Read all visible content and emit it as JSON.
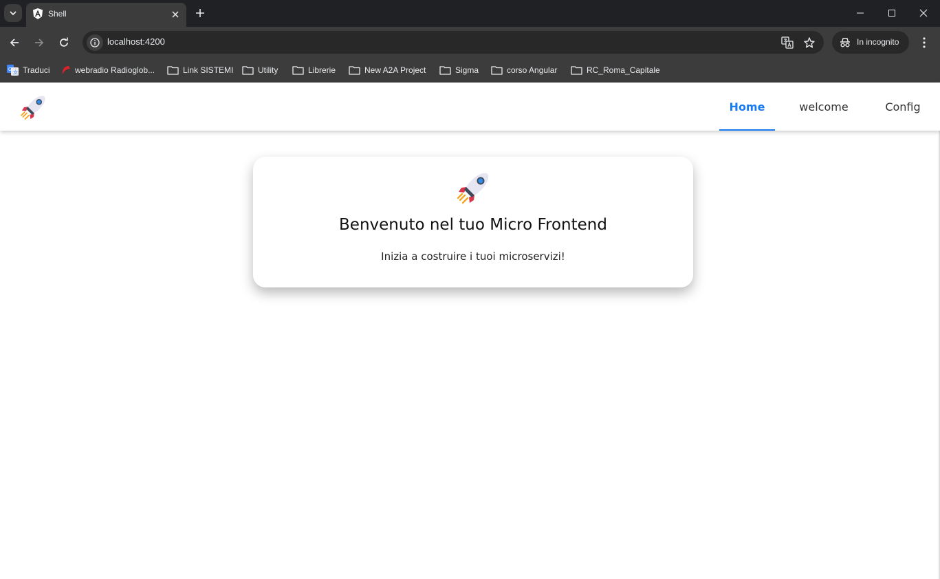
{
  "browser": {
    "tab": {
      "title": "Shell",
      "favicon": "angular-icon"
    },
    "address": {
      "url": "localhost:4200"
    },
    "incognito_label": "In incognito",
    "bookmarks": [
      {
        "label": "Traduci",
        "icon": "google-translate-icon"
      },
      {
        "label": "webradio Radioglob...",
        "icon": "radio-icon"
      },
      {
        "label": "Link SISTEMI",
        "icon": "folder-icon"
      },
      {
        "label": "Utility",
        "icon": "folder-icon"
      },
      {
        "label": "Librerie",
        "icon": "folder-icon"
      },
      {
        "label": "New A2A Project",
        "icon": "folder-icon"
      },
      {
        "label": "Sigma",
        "icon": "folder-icon"
      },
      {
        "label": "corso Angular",
        "icon": "folder-icon"
      },
      {
        "label": "RC_Roma_Capitale",
        "icon": "folder-icon"
      }
    ]
  },
  "app": {
    "logo": "rocket-icon",
    "nav": [
      {
        "label": "Home",
        "active": true
      },
      {
        "label": "welcome",
        "active": false
      },
      {
        "label": "Config",
        "active": false
      }
    ],
    "card": {
      "icon": "rocket-icon",
      "title": "Benvenuto nel tuo Micro Frontend",
      "subtitle": "Inizia a costruire i tuoi microservizi!"
    },
    "colors": {
      "accent": "#1a7cf2",
      "chrome_dark": "#202124",
      "chrome_toolbar": "#3c3c3c"
    }
  }
}
